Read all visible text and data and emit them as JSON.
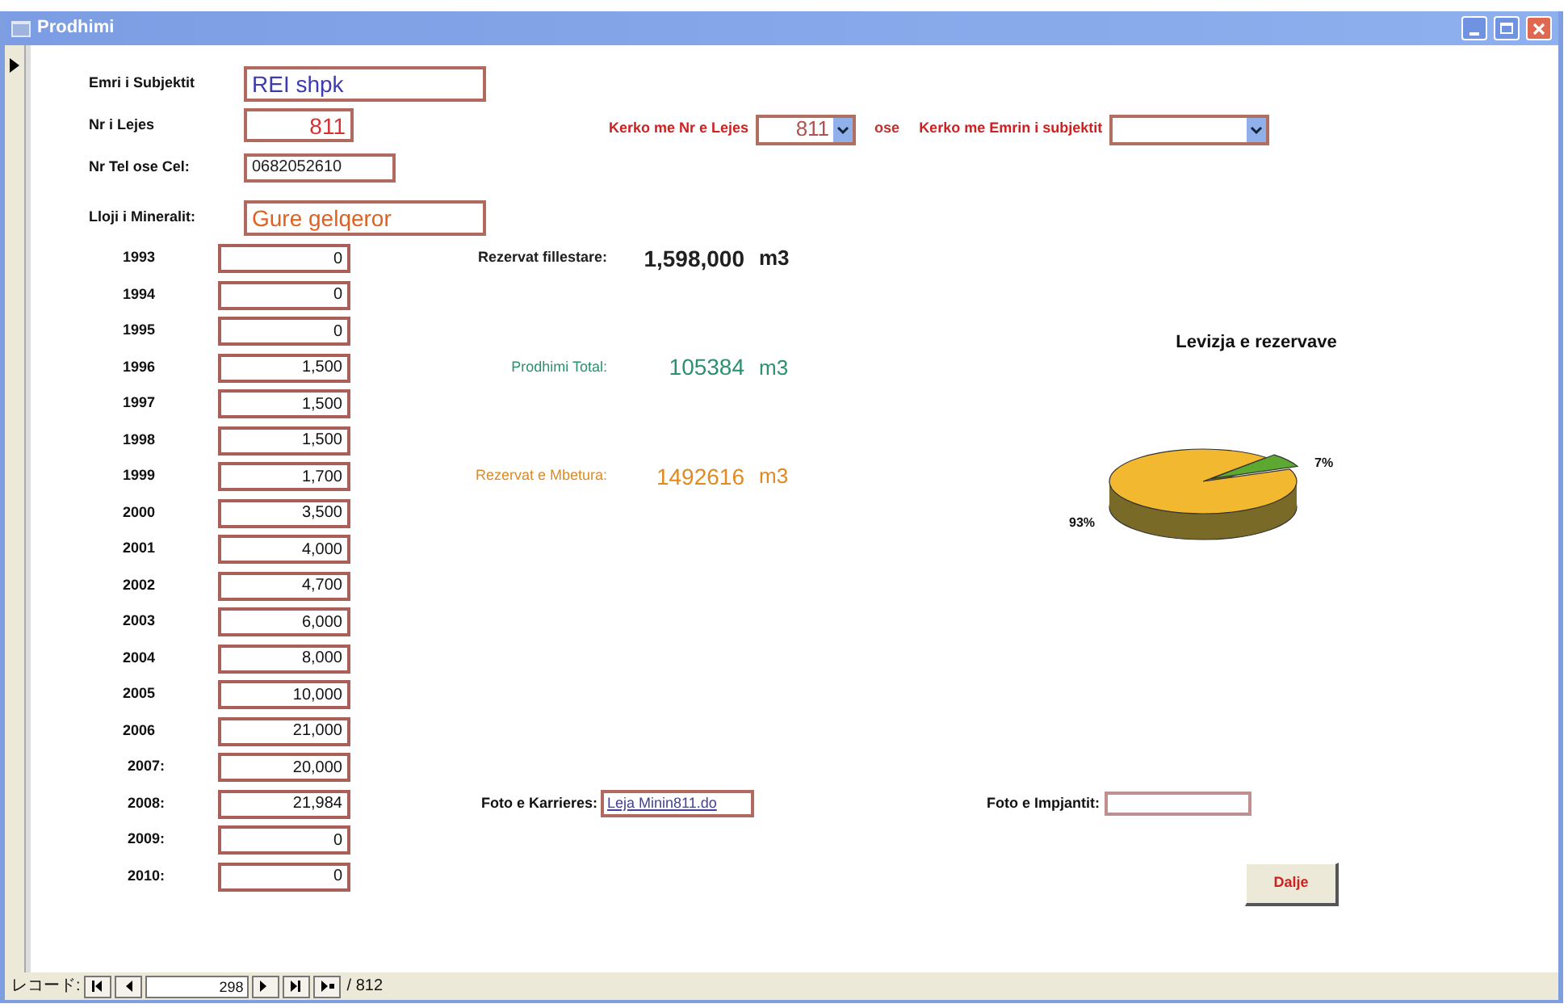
{
  "window": {
    "title": "Prodhimi"
  },
  "fields": [
    {
      "label": "Emri i Subjektit",
      "value": "REI shpk",
      "color": "#3c3cb0",
      "kind": "large"
    },
    {
      "label": "Nr i Lejes",
      "value": "811",
      "color": "#d83030",
      "kind": "number"
    },
    {
      "label": "Nr Tel ose Cel:",
      "value": "0682052610",
      "color": "#202020",
      "kind": "small"
    },
    {
      "label": "Lloji i Mineralit:",
      "value": "Gure gelqeror",
      "color": "#e06020",
      "kind": "large"
    }
  ],
  "search": {
    "by_permit": {
      "label": "Kerko me Nr e Lejes",
      "value": "811"
    },
    "separator": "ose",
    "by_name": {
      "label": "Kerko me Emrin i subjektit"
    }
  },
  "yearly_production": [
    {
      "year": "1993",
      "value": "0"
    },
    {
      "year": "1994",
      "value": "0"
    },
    {
      "year": "1995",
      "value": "0"
    },
    {
      "year": "1996",
      "value": "1,500"
    },
    {
      "year": "1997",
      "value": "1,500"
    },
    {
      "year": "1998",
      "value": "1,500"
    },
    {
      "year": "1999",
      "value": "1,700"
    },
    {
      "year": "2000",
      "value": "3,500"
    },
    {
      "year": "2001",
      "value": "4,000"
    },
    {
      "year": "2002",
      "value": "4,700"
    },
    {
      "year": "2003",
      "value": "6,000"
    },
    {
      "year": "2004",
      "value": "8,000"
    },
    {
      "year": "2005",
      "value": "10,000"
    },
    {
      "year": "2006",
      "value": "21,000"
    },
    {
      "year": "2007:",
      "value": "20,000"
    },
    {
      "year": "2008:",
      "value": "21,984"
    },
    {
      "year": "2009:",
      "value": "0"
    },
    {
      "year": "2010:",
      "value": "0"
    }
  ],
  "summary": [
    {
      "label": "Rezervat fillestare:",
      "value": "1,598,000",
      "unit": "m3",
      "color": "#202020"
    },
    {
      "label": "Prodhimi Total:",
      "value": "105384",
      "unit": "m3",
      "color": "#2a9070"
    },
    {
      "label": "Rezervat e Mbetura:",
      "value": "1492616",
      "unit": "m3",
      "color": "#e08a20"
    }
  ],
  "chart": {
    "chart_data": {
      "type": "pie",
      "title": "Levizja e rezervave",
      "values": [
        93,
        7
      ],
      "value_labels": [
        "93%",
        "7%"
      ]
    }
  },
  "photos": [
    {
      "label": "Foto e Karrieres:",
      "value": "Leja Minin811.do"
    },
    {
      "label": "Foto e Impjantit:"
    }
  ],
  "exit_button": "Dalje",
  "navigation": {
    "label": "レコード:",
    "current": "298",
    "total": "/ 812"
  }
}
